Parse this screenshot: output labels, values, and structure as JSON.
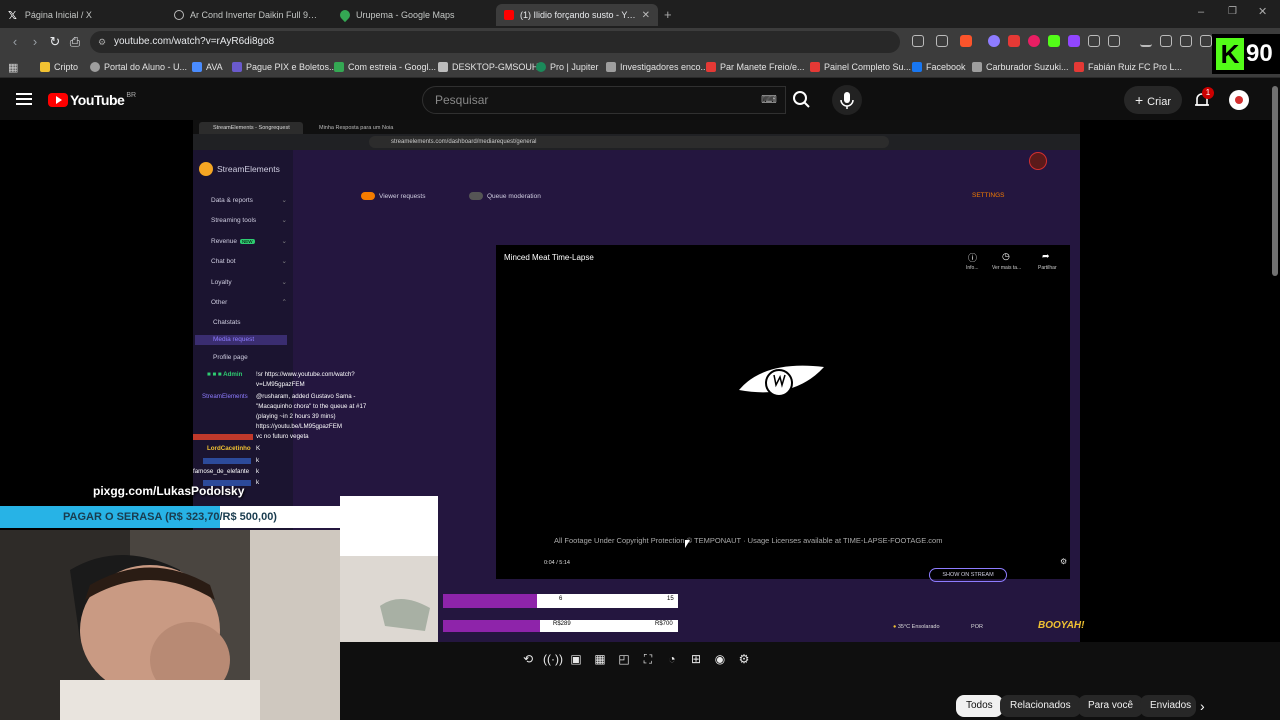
{
  "browser": {
    "tabs": [
      {
        "label": "Página Inicial / X",
        "icon": "x-icon",
        "active": false
      },
      {
        "label": "Ar Cond Inverter Daikin Full 9000 Bt",
        "icon": "globe-icon",
        "active": false
      },
      {
        "label": "Urupema - Google Maps",
        "icon": "maps-icon",
        "active": false
      },
      {
        "label": "(1) Ilidio forçando susto - You",
        "icon": "youtube-icon",
        "active": true
      }
    ],
    "url": "youtube.com/watch?v=rAyR6di8go8",
    "bookmarks": [
      {
        "label": "Cripto",
        "color": "#f1c232"
      },
      {
        "label": "Portal do Aluno - U...",
        "color": "#9e9e9e"
      },
      {
        "label": "AVA",
        "color": "#4a8cff"
      },
      {
        "label": "Pague PIX e Boletos...",
        "color": "#6a5acd"
      },
      {
        "label": "Com estreia - Googl...",
        "color": "#34a853"
      },
      {
        "label": "DESKTOP-GMSOUHF",
        "color": "#bdbdbd"
      },
      {
        "label": "Pro | Jupiter",
        "color": "#1b8a5a"
      },
      {
        "label": "Investigadores enco...",
        "color": "#9e9e9e"
      },
      {
        "label": "Par Manete Freio/e...",
        "color": "#e53935"
      },
      {
        "label": "Painel Completo Su...",
        "color": "#e53935"
      },
      {
        "label": "Facebook",
        "color": "#1877f2"
      },
      {
        "label": "Carburador Suzuki...",
        "color": "#9e9e9e"
      },
      {
        "label": "Fabián Ruiz FC Pro L...",
        "color": "#e53935"
      }
    ],
    "kick_label": "K",
    "kick_count": "90"
  },
  "youtube": {
    "logo_text": "YouTube",
    "region": "BR",
    "search_placeholder": "Pesquisar",
    "create_label": "Criar",
    "notification_count": "1",
    "chips": [
      "Todos",
      "Relacionados",
      "Para você",
      "Enviados"
    ]
  },
  "stream": {
    "inner_tabs": [
      "StreamElements - Songrequest",
      "Minha Resposta para um Noia"
    ],
    "inner_url": "streamelements.com/dashboard/mediarequest/general",
    "brand": "StreamElements",
    "sidebar": [
      {
        "label": "Data & reports",
        "arrow": "⌄"
      },
      {
        "label": "Streaming tools",
        "arrow": "⌄"
      },
      {
        "label": "Revenue",
        "arrow": "⌄",
        "badge": "NEW"
      },
      {
        "label": "Chat bot",
        "arrow": "⌄"
      },
      {
        "label": "Loyalty",
        "arrow": "⌄"
      },
      {
        "label": "Other",
        "arrow": "⌃"
      },
      {
        "label": "Chatstats",
        "arrow": ""
      },
      {
        "label": "Media request",
        "arrow": ""
      },
      {
        "label": "Profile page",
        "arrow": ""
      }
    ],
    "viewer_requests": "Viewer requests",
    "queue_moderation": "Queue moderation",
    "settings": "SETTINGS",
    "video_title": "Minced Meat Time-Lapse",
    "video_actions": [
      "Info...",
      "Ver mais ta...",
      "Partilhar"
    ],
    "watermark": "All Footage Under Copyright Protection  © TEMPONAUT  ·  Usage Licenses available at TIME-LAPSE-FOOTAGE.com",
    "time": "0:04 / 5:14",
    "show_on_stream": "SHOW ON STREAM",
    "chat": [
      {
        "name": "■ ■ ■ Admin",
        "msg": "!sr https://www.youtube.com/watch?v=LM95gpazFEM",
        "color": "#2ecc71"
      },
      {
        "name": "StreamElements",
        "msg": "@rusharam, added Gustavo Sama - \"Macaquinho chora\" to the queue at #17 (playing ~in 2 hours 39 mins) https://youtu.be/LM95gpazFEM",
        "color": "#8e7cff"
      },
      {
        "name": "",
        "msg": "vc no futuro vegeta",
        "color": "#e53935"
      },
      {
        "name": "LordCacetinho",
        "msg": "K",
        "color": "#f1c232"
      },
      {
        "name": "",
        "msg": "k",
        "color": "#3a7bff"
      },
      {
        "name": "famose_de_elefante",
        "msg": "k",
        "color": "#ffffff"
      },
      {
        "name": "",
        "msg": "k",
        "color": "#3a7bff"
      }
    ],
    "overlay_url": "pixgg.com/LukasPodolsky",
    "donation_goal": "PAGAR O SERASA (R$ 323,70/R$ 500,00)",
    "donation_progress": 0.6474,
    "bar1_left": "6",
    "bar1_right": "15",
    "bar2_left": "R$289",
    "bar2_right": "R$700",
    "taskbar_weather": "35°C Ensolarado",
    "taskbar_lang": "POR",
    "booyah": "BOOYAH!"
  }
}
